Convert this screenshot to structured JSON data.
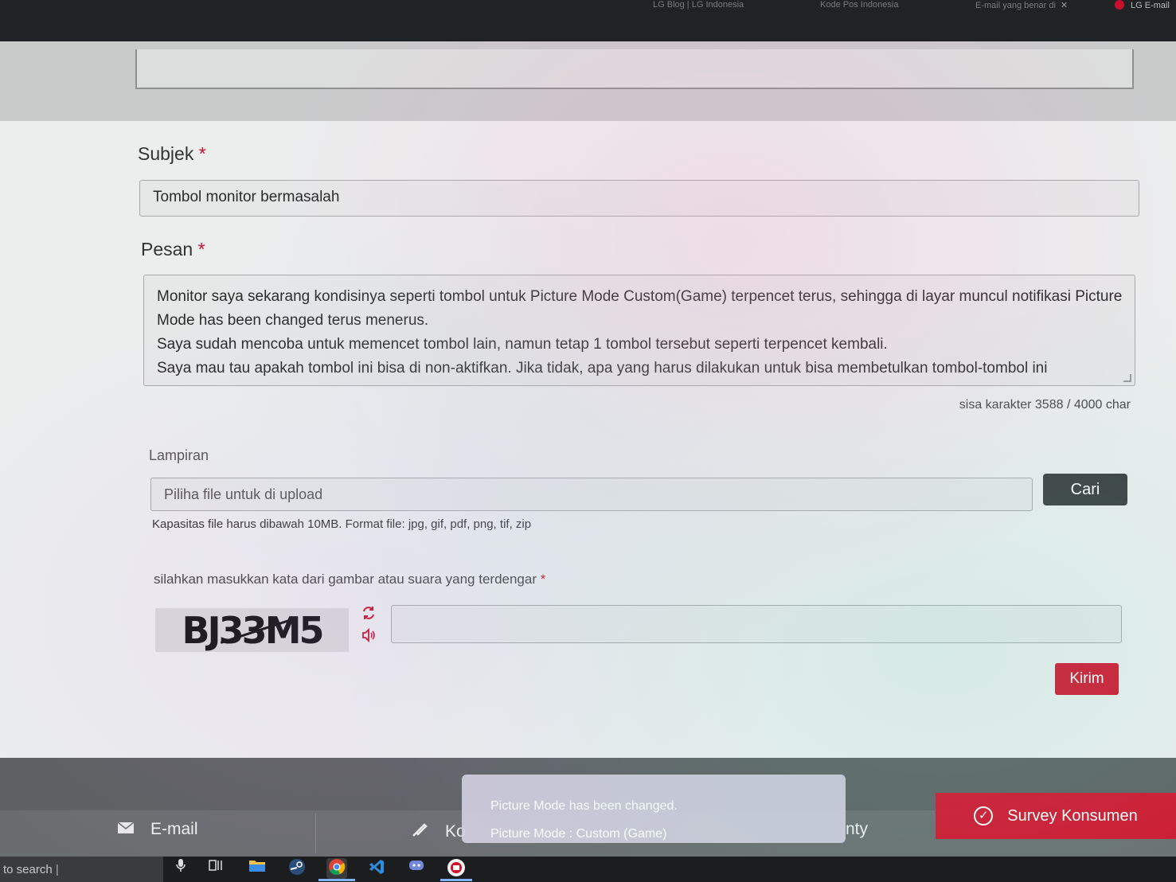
{
  "browser": {
    "tabs": [
      {
        "label": "LG Blog | LG Indonesia"
      },
      {
        "label": "Kode Pos Indonesia"
      },
      {
        "label": "E-mail yang benar di"
      },
      {
        "label": "LG E-mail"
      }
    ]
  },
  "form": {
    "subject": {
      "label": "Subjek",
      "required_mark": "*",
      "value": "Tombol monitor bermasalah"
    },
    "message": {
      "label": "Pesan",
      "required_mark": "*",
      "lines": [
        "Monitor saya sekarang kondisinya seperti tombol untuk Picture Mode Custom(Game) terpencet terus, sehingga di layar muncul notifikasi Picture",
        "Mode has been changed terus menerus.",
        "Saya sudah mencoba untuk memencet tombol lain, namun tetap 1 tombol tersebut seperti terpencet kembali.",
        "Saya mau tau apakah tombol ini bisa di non-aktifkan. Jika tidak, apa yang harus dilakukan untuk bisa membetulkan tombol-tombol ini"
      ],
      "char_count": "sisa karakter 3588 / 4000 char"
    },
    "attachment": {
      "label": "Lampiran",
      "placeholder": "Piliha file untuk di upload",
      "browse_label": "Cari",
      "hint": "Kapasitas file harus dibawah 10MB. Format file: jpg, gif, pdf, png, tif, zip"
    },
    "captcha": {
      "label": "silahkan masukkan kata dari gambar atau suara yang terdengar",
      "required_mark": "*",
      "image_text": "BJ33M5",
      "refresh_icon": "refresh-icon",
      "audio_icon": "speaker-icon",
      "value": ""
    },
    "submit_label": "Kirim"
  },
  "footer": {
    "email_label": "E-mail",
    "middle_label_left": "Ko",
    "middle_label_right": "nty",
    "survey_label": "Survey Konsumen"
  },
  "osd": {
    "line1": "Picture Mode has been changed.",
    "line2": "Picture Mode  : Custom (Game)"
  },
  "taskbar": {
    "search_text": "to search",
    "icons": [
      "mic-icon",
      "task-view-icon",
      "file-explorer-icon",
      "steam-icon",
      "chrome-icon",
      "vscode-icon",
      "discord-icon",
      "app-icon"
    ]
  },
  "colors": {
    "accent_red": "#d3122b",
    "dark_button": "#3a3c3e"
  }
}
